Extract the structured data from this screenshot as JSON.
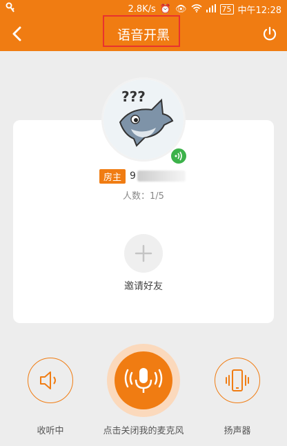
{
  "status_bar": {
    "speed": "2.8K/s",
    "battery": "75",
    "time": "中午12:28"
  },
  "header": {
    "title": "语音开黑"
  },
  "room": {
    "owner_badge": "房主",
    "owner_name_prefix": "9",
    "count_label": "人数：1/5",
    "invite_label": "邀请好友"
  },
  "controls": {
    "listen_label": "收听中",
    "mic_label": "点击关闭我的麦克风",
    "speaker_label": "扬声器"
  },
  "colors": {
    "brand": "#f07c12",
    "highlight": "#e8322f",
    "speaking": "#3cb24a"
  }
}
